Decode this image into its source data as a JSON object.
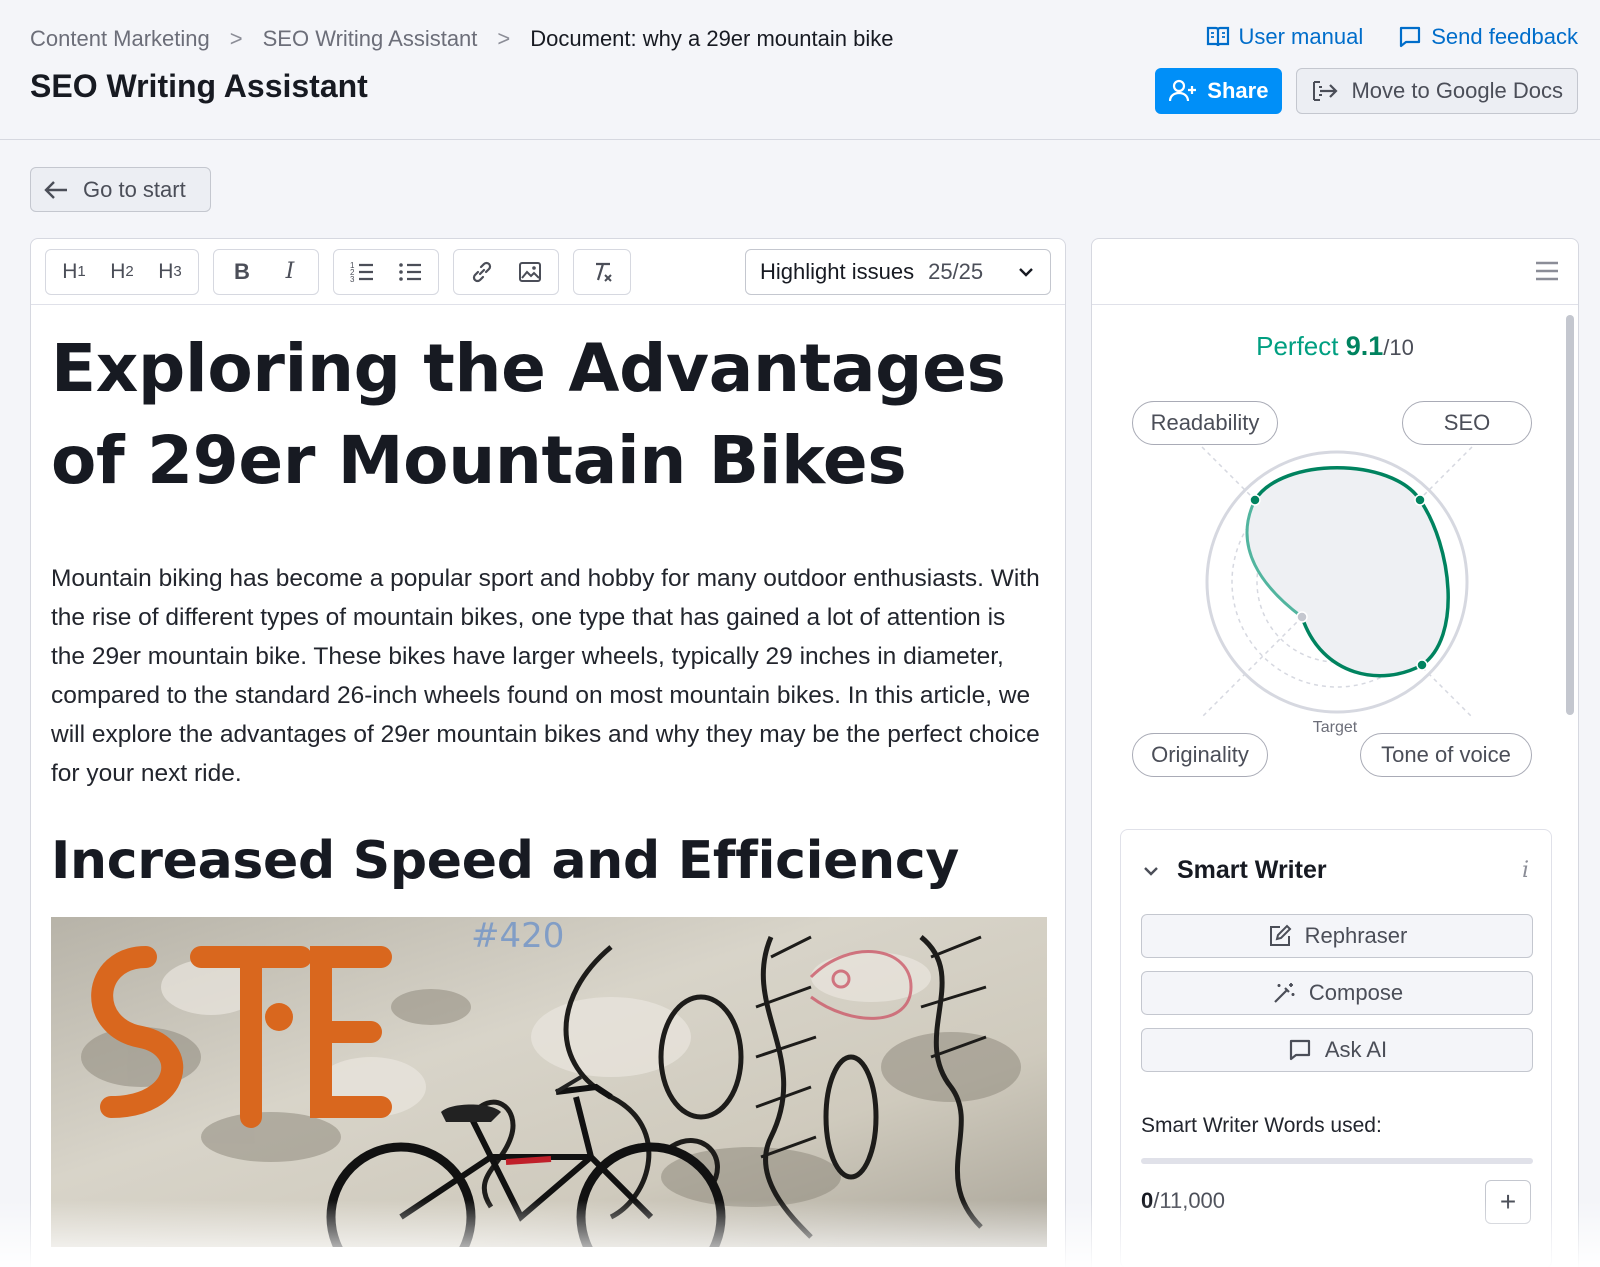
{
  "breadcrumb": {
    "items": [
      "Content Marketing",
      "SEO Writing Assistant"
    ],
    "current": "Document: why a 29er mountain bike",
    "separator": ">"
  },
  "page_title": "SEO Writing Assistant",
  "top_links": {
    "user_manual": "User manual",
    "send_feedback": "Send feedback"
  },
  "actions": {
    "share": "Share",
    "google_docs": "Move to Google Docs"
  },
  "go_to_start": "Go to start",
  "toolbar": {
    "h1": "H",
    "h2": "H",
    "h3": "H",
    "h1_sub": "1",
    "h2_sub": "2",
    "h3_sub": "3",
    "bold": "B",
    "italic": "I",
    "highlight_label": "Highlight issues",
    "highlight_count": "25/25"
  },
  "document": {
    "title": "Exploring the Advantages of 29er Mountain Bikes",
    "intro": "Mountain biking has become a popular sport and hobby for many outdoor enthusiasts. With the rise of different types of mountain bikes, one type that has gained a lot of attention is the 29er mountain bike. These bikes have larger wheels, typically 29 inches in diameter, compared to the standard 26-inch wheels found on most mountain bikes. In this article, we will explore the advantages of 29er mountain bikes and why they may be the perfect choice for your next ride.",
    "section_heading": "Increased Speed and Efficiency"
  },
  "score_panel": {
    "label": "Perfect",
    "score": "9.1",
    "max": "/10",
    "pills": {
      "readability": "Readability",
      "seo": "SEO",
      "originality": "Originality",
      "tone": "Tone of voice"
    },
    "target_label": "Target"
  },
  "smart_writer": {
    "title": "Smart Writer",
    "info": "i",
    "rephraser": "Rephraser",
    "compose": "Compose",
    "ask_ai": "Ask AI",
    "words_label": "Smart Writer Words used:",
    "words_used": "0",
    "words_total": "/11,000",
    "words_fraction": 0,
    "plus": "+"
  },
  "colors": {
    "accent_blue": "#008ff8",
    "link_blue": "#006dca",
    "score_green": "#009f81"
  }
}
